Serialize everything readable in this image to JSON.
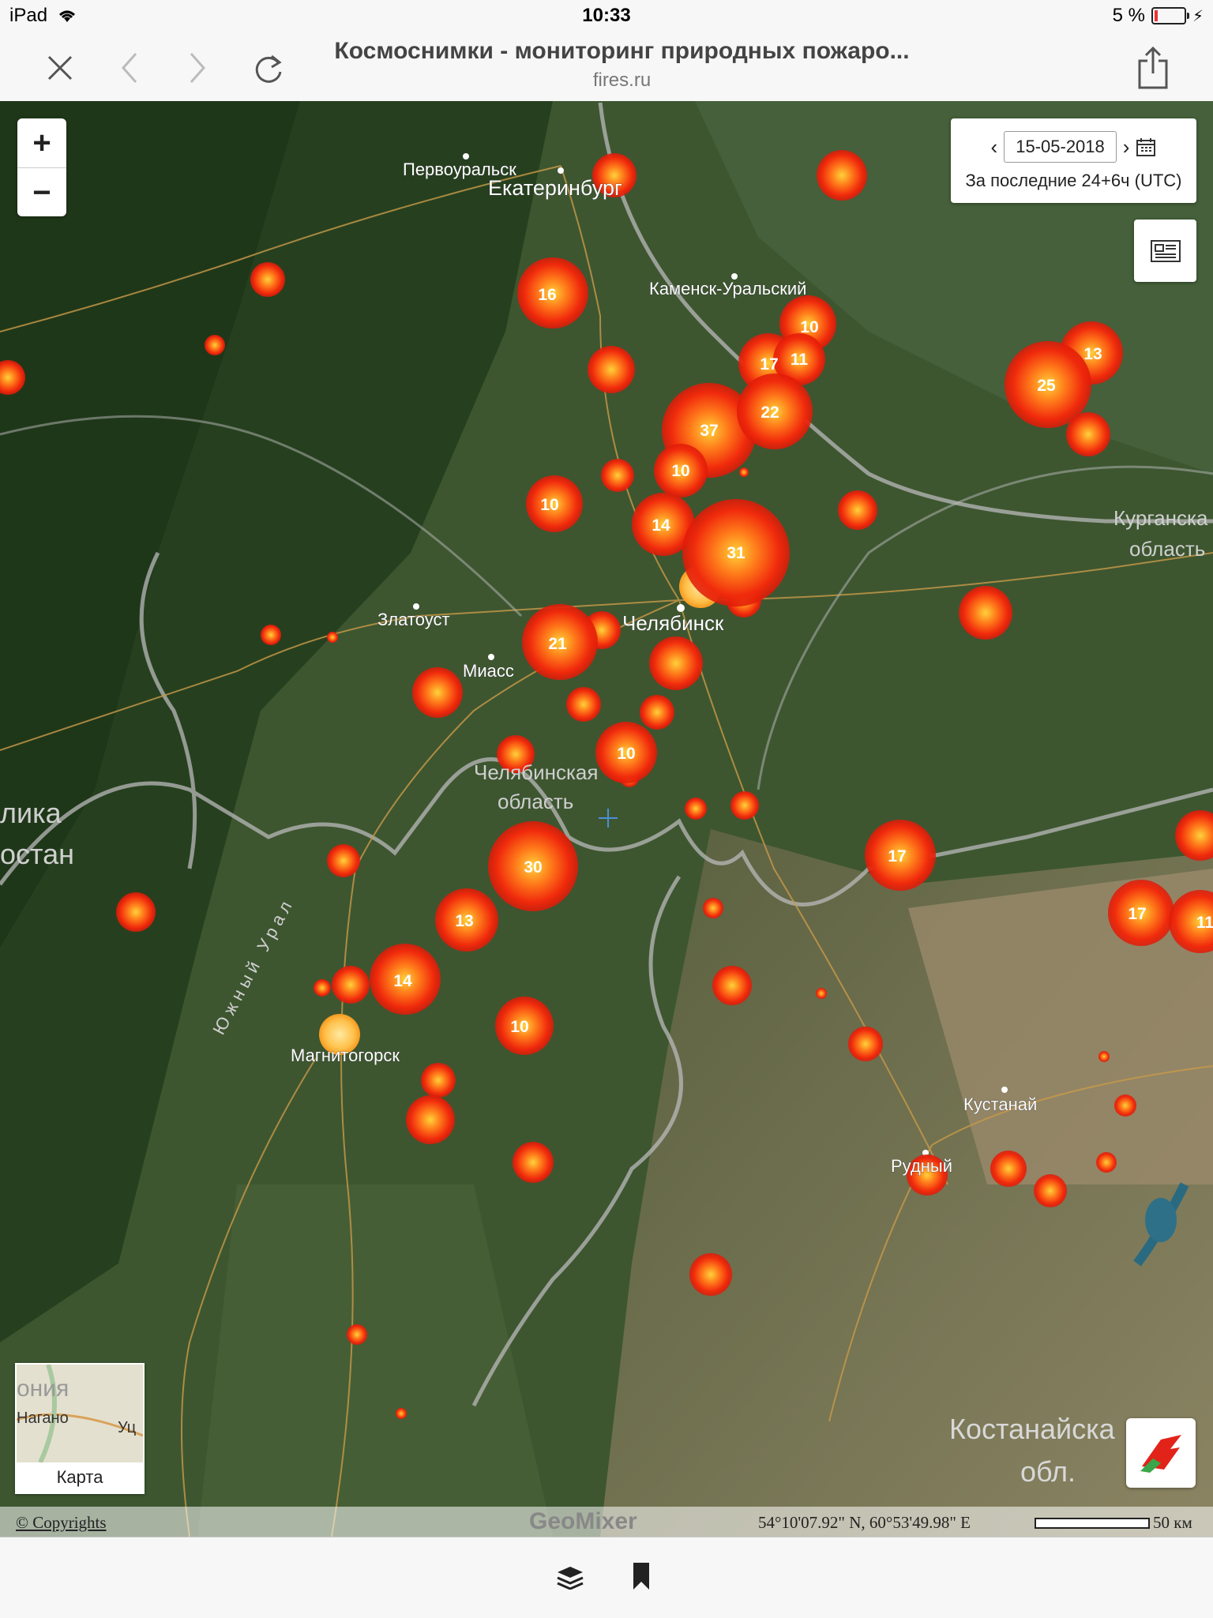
{
  "status_bar": {
    "device": "iPad",
    "time": "10:33",
    "battery": "5 %"
  },
  "browser": {
    "page_title": "Космоснимки - мониторинг природных пожаро...",
    "url": "fires.ru"
  },
  "map": {
    "date": "15-05-2018",
    "period": "За последние 24+6ч (UTC)",
    "minimap_label": "Карта",
    "minimap_fragments": [
      "ония",
      "Нагано",
      "Уц"
    ],
    "copyrights": "© Copyrights",
    "provider": "GeoMixer",
    "coordinates": "54°10'07.92\" N, 60°53'49.98\" E",
    "scale_label": "50 км",
    "places": [
      {
        "id": "pervouralsk",
        "name": "Первоуральск"
      },
      {
        "id": "ekaterinburg",
        "name": "Екатеринбург"
      },
      {
        "id": "kamensk",
        "name": "Каменск-Уральский"
      },
      {
        "id": "zlatoust",
        "name": "Златоуст"
      },
      {
        "id": "chelyabinsk",
        "name": "Челябинск"
      },
      {
        "id": "miass",
        "name": "Миасс"
      },
      {
        "id": "chel_obl_1",
        "name": "Челябинская"
      },
      {
        "id": "chel_obl_2",
        "name": "область"
      },
      {
        "id": "kurgan_1",
        "name": "Курганска"
      },
      {
        "id": "kurgan_2",
        "name": "область"
      },
      {
        "id": "bash_1",
        "name": "лика"
      },
      {
        "id": "bash_2",
        "name": "остан"
      },
      {
        "id": "yuzh_ural",
        "name": "Южный Урал"
      },
      {
        "id": "magnitogorsk",
        "name": "Магнитогорск"
      },
      {
        "id": "kustanai",
        "name": "Кустанай"
      },
      {
        "id": "rudny",
        "name": "Рудный"
      },
      {
        "id": "kost_1",
        "name": "Костанайска"
      },
      {
        "id": "kost_2",
        "name": "обл."
      }
    ],
    "fire_clusters": [
      "16",
      "10",
      "17",
      "11",
      "13",
      "25",
      "37",
      "22",
      "10",
      "10",
      "14",
      "31",
      "21",
      "10",
      "30",
      "17",
      "13",
      "17",
      "11",
      "14",
      "10"
    ]
  }
}
